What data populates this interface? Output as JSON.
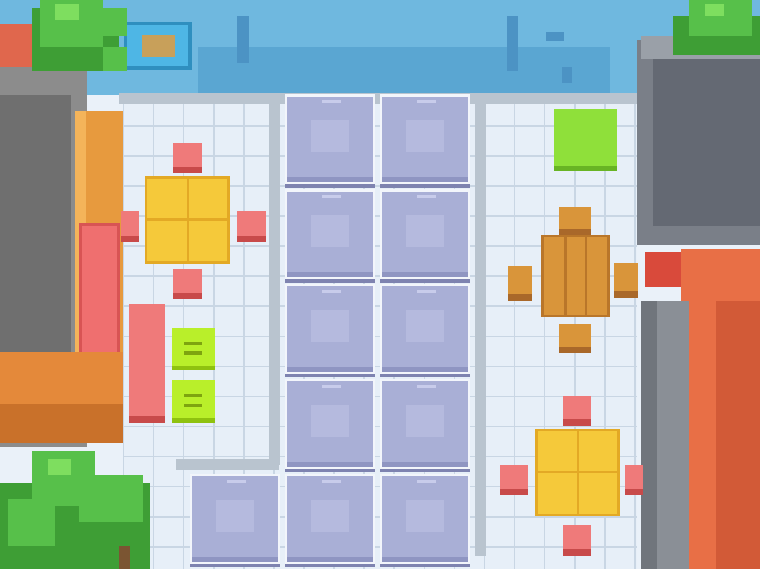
{
  "scene": {
    "type": "puzzle-board",
    "board": {
      "tiles": [
        {
          "id": "r1c2"
        },
        {
          "id": "r1c3"
        },
        {
          "id": "r2c2"
        },
        {
          "id": "r2c3"
        },
        {
          "id": "r3c2"
        },
        {
          "id": "r3c3"
        },
        {
          "id": "r4c2"
        },
        {
          "id": "r4c3"
        },
        {
          "id": "r5c1"
        },
        {
          "id": "r5c2"
        },
        {
          "id": "r5c3"
        }
      ],
      "empty_tile_count": 11
    },
    "colors": {
      "water": "#6fb8df",
      "floor": "#e7eff8",
      "tile": "#a9afd6",
      "yellow_table": "#f5c93a",
      "red_stool": "#ef7a7a",
      "wood_table": "#d9953a",
      "green_crate": "#b9ef2a",
      "tree_leaf": "#57c04a"
    },
    "icons": [
      "tree-icon",
      "table-icon",
      "stool-icon",
      "crate-icon",
      "bench-icon",
      "sign-icon"
    ]
  }
}
